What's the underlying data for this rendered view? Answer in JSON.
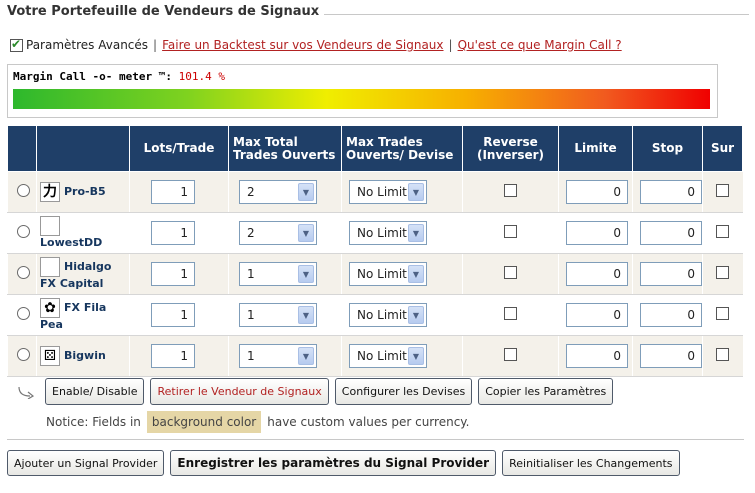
{
  "page": {
    "title": "Votre Portefeuille de Vendeurs de Signaux"
  },
  "links": {
    "advanced_label": "Paramètres Avancés",
    "backtest_link": "Faire un Backtest sur vos Vendeurs de Signaux",
    "margin_call_link": "Qu'est ce que Margin Call ?"
  },
  "meter": {
    "label": "Margin Call -o- meter ™:",
    "value": "101.4 %",
    "level_percent": 101.4
  },
  "table": {
    "headers": {
      "lots": "Lots/Trade",
      "max_total": "Max Total Trades Ouverts",
      "max_trades_devise": "Max Trades Ouverts/ Devise",
      "reverse": "Reverse (Inverser)",
      "limite": "Limite",
      "stop": "Stop",
      "sur": "Sur"
    },
    "rows": [
      {
        "name_line1": "Pro-B5",
        "name_line2": "",
        "logo_icon": "kanji-logo-icon",
        "logo_glyph": "力",
        "lots": "1",
        "max_total": "2",
        "max_devise": "No Limit",
        "limite": "0",
        "stop": "0"
      },
      {
        "name_line1": "",
        "name_line2": "LowestDD",
        "logo_icon": "portrait-photo-icon",
        "logo_glyph": "",
        "lots": "1",
        "max_total": "2",
        "max_devise": "No Limit",
        "limite": "0",
        "stop": "0"
      },
      {
        "name_line1": "Hidalgo",
        "name_line2": "FX Capital",
        "logo_icon": "hidalgo-logo-icon",
        "logo_glyph": "",
        "lots": "1",
        "max_total": "1",
        "max_devise": "No Limit",
        "limite": "0",
        "stop": "0"
      },
      {
        "name_line1": "FX Fila",
        "name_line2": "Pea",
        "logo_icon": "flower-logo-icon",
        "logo_glyph": "✿",
        "lots": "1",
        "max_total": "1",
        "max_devise": "No Limit",
        "limite": "0",
        "stop": "0"
      },
      {
        "name_line1": "Bigwin",
        "name_line2": "",
        "logo_icon": "dice-logo-icon",
        "logo_glyph": "⚄",
        "lots": "1",
        "max_total": "1",
        "max_devise": "No Limit",
        "limite": "0",
        "stop": "0"
      }
    ]
  },
  "actions": {
    "enable_disable": "Enable/ Disable",
    "retirer": "Retirer le Vendeur de Signaux",
    "configurer": "Configurer les Devises",
    "copier": "Copier les Paramètres"
  },
  "notice": {
    "prefix": "Notice: Fields in",
    "highlight": "background color",
    "suffix": "have custom values per currency."
  },
  "bottom": {
    "add_provider": "Ajouter un Signal Provider",
    "save_settings": "Enregistrer les paramètres du Signal Provider",
    "reset": "Reinitialiser les Changements"
  },
  "colors": {
    "header_bg": "#1f3f68",
    "alt_row_bg": "#f4f1ea",
    "link_red": "#b22222",
    "notice_highlight": "#e5d6a6"
  }
}
